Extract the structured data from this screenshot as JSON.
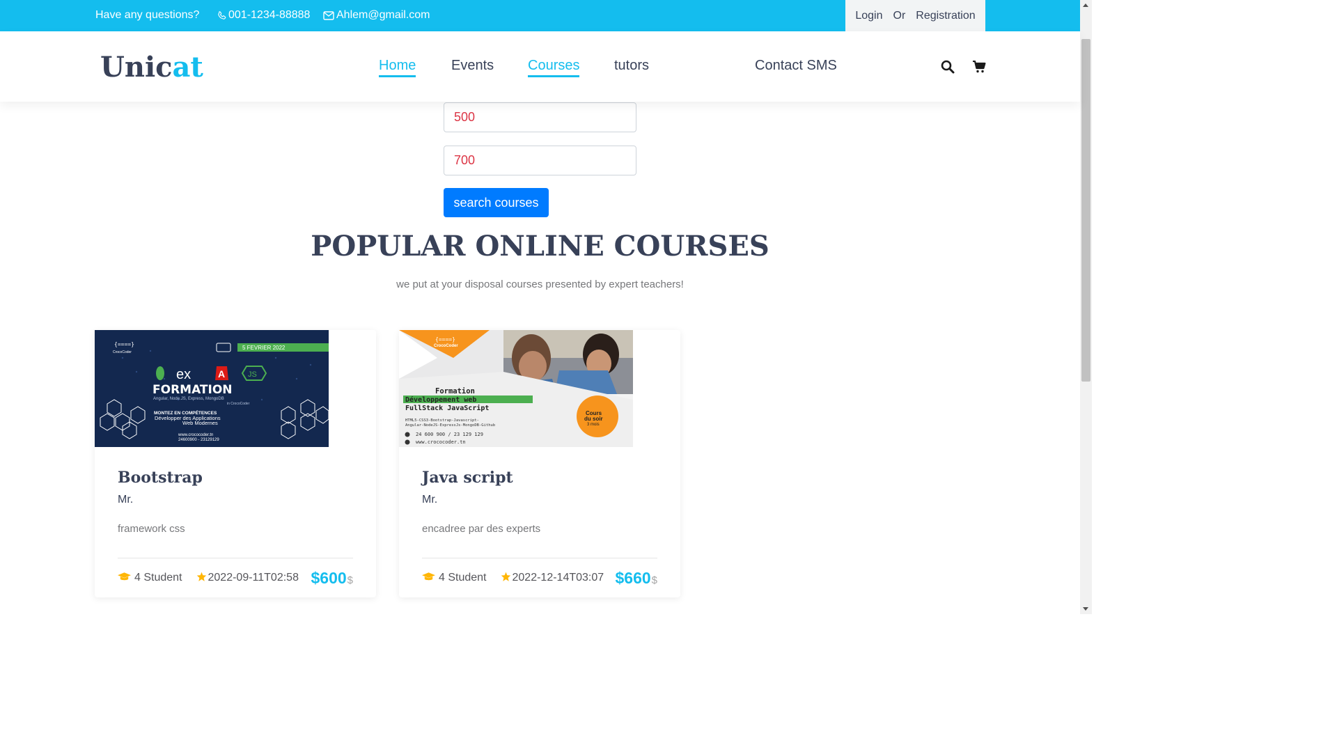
{
  "topbar": {
    "question": "Have any questions?",
    "phone": "001-1234-88888",
    "email": "Ahlem@gmail.com",
    "login": "Login",
    "or": "Or",
    "registration": "Registration"
  },
  "header": {
    "logo_main": "Unic",
    "logo_accent": "at",
    "nav": [
      "Home",
      "Events",
      "Courses",
      "tutors",
      "Contact SMS"
    ],
    "active_nav": [
      "Home",
      "Courses"
    ]
  },
  "search": {
    "min_value": "500",
    "max_value": "700",
    "button_label": "search courses"
  },
  "section": {
    "title": "POPULAR ONLINE COURSES",
    "subtitle": "we put at your disposal courses presented by expert teachers!"
  },
  "courses": [
    {
      "title": "Bootstrap",
      "teacher": "Mr.",
      "description": "framework css",
      "students": "4 Student",
      "date": "2022-09-11T02:58",
      "price": "$600",
      "currency": "$",
      "image": {
        "date_banner": "5 FEVRIER 2022",
        "heading": "FORMATION",
        "tech_line": "Angular, Node.JS, Express, MongoDB",
        "brand_line": "in CrocoCoder",
        "tagline_1": "MONTEZ EN COMPÉTENCES",
        "tagline_2": "Développer des Applications",
        "tagline_3": "Web Modernes",
        "site": "www.crococoder.tn",
        "phones": "24600900 - 23129129"
      }
    },
    {
      "title": "Java script",
      "teacher": "Mr.",
      "description": "encadree par des experts",
      "students": "4 Student",
      "date": "2022-12-14T03:07",
      "price": "$660",
      "currency": "$",
      "image": {
        "brand": "CrocoCoder",
        "line_1": "Formation",
        "line_2": "Développement web",
        "line_3": "FullStack JavaScript",
        "stack_1": "HTML5-CSS3-Bootstrap-Javascript-",
        "stack_2": "Angular-NodeJS-ExpressJs-MongoDB-Github",
        "phones": "24 600 900 / 23 129 129",
        "site": "www.crococoder.tn",
        "badge_1": "Cours",
        "badge_2": "du soir",
        "badge_3": "3 mois"
      }
    }
  ],
  "colors": {
    "accent": "#14bdee",
    "primary_button": "#007bff",
    "heading": "#384158",
    "input_text": "#dc3545",
    "star": "#ffb606"
  }
}
